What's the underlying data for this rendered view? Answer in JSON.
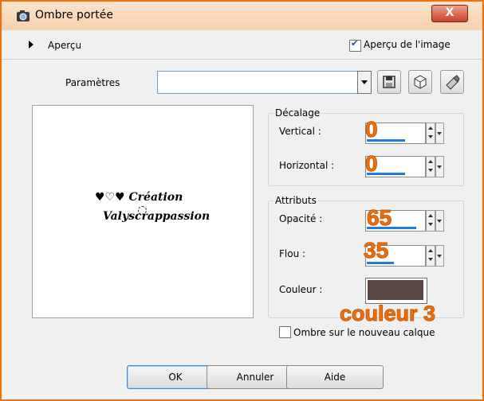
{
  "window": {
    "title": "Ombre portée",
    "close_label": "X"
  },
  "preview_row": {
    "label": "Aperçu",
    "image_preview_label": "Aperçu de l'image",
    "image_preview_checked": true
  },
  "parameters": {
    "label": "Paramètres",
    "value": ""
  },
  "preview_image": {
    "line1": "♥♡♥ Création",
    "line2": "Valyscrappassion"
  },
  "offset": {
    "title": "Décalage",
    "vertical_label": "Vertical :",
    "vertical_value": "0",
    "horizontal_label": "Horizontal :",
    "horizontal_value": "0"
  },
  "attributes": {
    "title": "Attributs",
    "opacity_label": "Opacité :",
    "opacity_value": "65",
    "blur_label": "Flou :",
    "blur_value": "35",
    "color_label": "Couleur :",
    "color_value": "#5a4642",
    "color_note": "couleur 3"
  },
  "new_layer": {
    "label": "Ombre sur le nouveau calque",
    "checked": false
  },
  "buttons": {
    "ok": "OK",
    "cancel": "Annuler",
    "help": "Aide"
  },
  "colors": {
    "accent_orange": "#f07010",
    "frame": "#f0700a",
    "focus_blue": "#1e7be0"
  }
}
